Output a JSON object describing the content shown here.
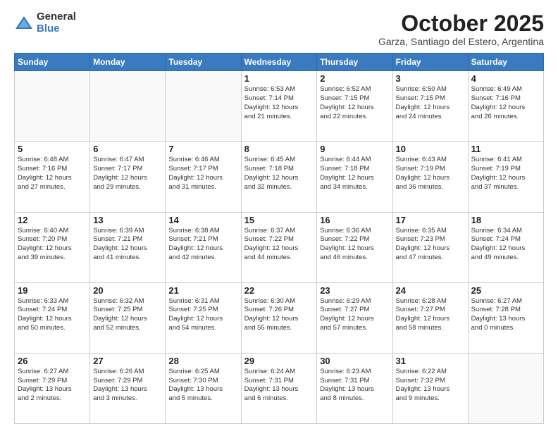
{
  "logo": {
    "general": "General",
    "blue": "Blue"
  },
  "header": {
    "month": "October 2025",
    "location": "Garza, Santiago del Estero, Argentina"
  },
  "days_of_week": [
    "Sunday",
    "Monday",
    "Tuesday",
    "Wednesday",
    "Thursday",
    "Friday",
    "Saturday"
  ],
  "weeks": [
    [
      {
        "day": "",
        "info": ""
      },
      {
        "day": "",
        "info": ""
      },
      {
        "day": "",
        "info": ""
      },
      {
        "day": "1",
        "info": "Sunrise: 6:53 AM\nSunset: 7:14 PM\nDaylight: 12 hours\nand 21 minutes."
      },
      {
        "day": "2",
        "info": "Sunrise: 6:52 AM\nSunset: 7:15 PM\nDaylight: 12 hours\nand 22 minutes."
      },
      {
        "day": "3",
        "info": "Sunrise: 6:50 AM\nSunset: 7:15 PM\nDaylight: 12 hours\nand 24 minutes."
      },
      {
        "day": "4",
        "info": "Sunrise: 6:49 AM\nSunset: 7:16 PM\nDaylight: 12 hours\nand 26 minutes."
      }
    ],
    [
      {
        "day": "5",
        "info": "Sunrise: 6:48 AM\nSunset: 7:16 PM\nDaylight: 12 hours\nand 27 minutes."
      },
      {
        "day": "6",
        "info": "Sunrise: 6:47 AM\nSunset: 7:17 PM\nDaylight: 12 hours\nand 29 minutes."
      },
      {
        "day": "7",
        "info": "Sunrise: 6:46 AM\nSunset: 7:17 PM\nDaylight: 12 hours\nand 31 minutes."
      },
      {
        "day": "8",
        "info": "Sunrise: 6:45 AM\nSunset: 7:18 PM\nDaylight: 12 hours\nand 32 minutes."
      },
      {
        "day": "9",
        "info": "Sunrise: 6:44 AM\nSunset: 7:18 PM\nDaylight: 12 hours\nand 34 minutes."
      },
      {
        "day": "10",
        "info": "Sunrise: 6:43 AM\nSunset: 7:19 PM\nDaylight: 12 hours\nand 36 minutes."
      },
      {
        "day": "11",
        "info": "Sunrise: 6:41 AM\nSunset: 7:19 PM\nDaylight: 12 hours\nand 37 minutes."
      }
    ],
    [
      {
        "day": "12",
        "info": "Sunrise: 6:40 AM\nSunset: 7:20 PM\nDaylight: 12 hours\nand 39 minutes."
      },
      {
        "day": "13",
        "info": "Sunrise: 6:39 AM\nSunset: 7:21 PM\nDaylight: 12 hours\nand 41 minutes."
      },
      {
        "day": "14",
        "info": "Sunrise: 6:38 AM\nSunset: 7:21 PM\nDaylight: 12 hours\nand 42 minutes."
      },
      {
        "day": "15",
        "info": "Sunrise: 6:37 AM\nSunset: 7:22 PM\nDaylight: 12 hours\nand 44 minutes."
      },
      {
        "day": "16",
        "info": "Sunrise: 6:36 AM\nSunset: 7:22 PM\nDaylight: 12 hours\nand 46 minutes."
      },
      {
        "day": "17",
        "info": "Sunrise: 6:35 AM\nSunset: 7:23 PM\nDaylight: 12 hours\nand 47 minutes."
      },
      {
        "day": "18",
        "info": "Sunrise: 6:34 AM\nSunset: 7:24 PM\nDaylight: 12 hours\nand 49 minutes."
      }
    ],
    [
      {
        "day": "19",
        "info": "Sunrise: 6:33 AM\nSunset: 7:24 PM\nDaylight: 12 hours\nand 50 minutes."
      },
      {
        "day": "20",
        "info": "Sunrise: 6:32 AM\nSunset: 7:25 PM\nDaylight: 12 hours\nand 52 minutes."
      },
      {
        "day": "21",
        "info": "Sunrise: 6:31 AM\nSunset: 7:25 PM\nDaylight: 12 hours\nand 54 minutes."
      },
      {
        "day": "22",
        "info": "Sunrise: 6:30 AM\nSunset: 7:26 PM\nDaylight: 12 hours\nand 55 minutes."
      },
      {
        "day": "23",
        "info": "Sunrise: 6:29 AM\nSunset: 7:27 PM\nDaylight: 12 hours\nand 57 minutes."
      },
      {
        "day": "24",
        "info": "Sunrise: 6:28 AM\nSunset: 7:27 PM\nDaylight: 12 hours\nand 58 minutes."
      },
      {
        "day": "25",
        "info": "Sunrise: 6:27 AM\nSunset: 7:28 PM\nDaylight: 13 hours\nand 0 minutes."
      }
    ],
    [
      {
        "day": "26",
        "info": "Sunrise: 6:27 AM\nSunset: 7:29 PM\nDaylight: 13 hours\nand 2 minutes."
      },
      {
        "day": "27",
        "info": "Sunrise: 6:26 AM\nSunset: 7:29 PM\nDaylight: 13 hours\nand 3 minutes."
      },
      {
        "day": "28",
        "info": "Sunrise: 6:25 AM\nSunset: 7:30 PM\nDaylight: 13 hours\nand 5 minutes."
      },
      {
        "day": "29",
        "info": "Sunrise: 6:24 AM\nSunset: 7:31 PM\nDaylight: 13 hours\nand 6 minutes."
      },
      {
        "day": "30",
        "info": "Sunrise: 6:23 AM\nSunset: 7:31 PM\nDaylight: 13 hours\nand 8 minutes."
      },
      {
        "day": "31",
        "info": "Sunrise: 6:22 AM\nSunset: 7:32 PM\nDaylight: 13 hours\nand 9 minutes."
      },
      {
        "day": "",
        "info": ""
      }
    ]
  ]
}
